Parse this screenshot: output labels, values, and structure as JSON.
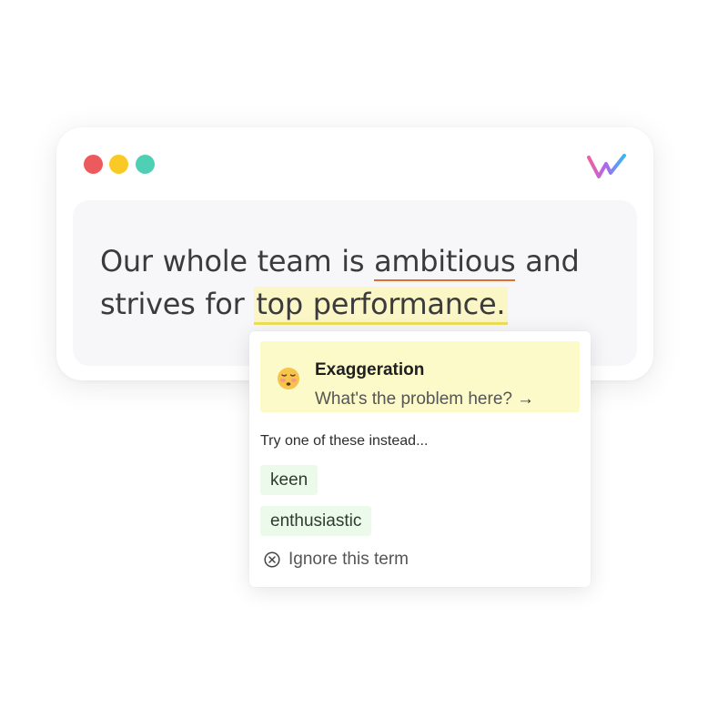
{
  "window": {
    "controls": [
      "close",
      "minimize",
      "maximize"
    ],
    "logo": "writing-assistant-logo",
    "colors": {
      "close": "#ec5a5e",
      "minimize": "#f9c926",
      "maximize": "#4fcfb3"
    }
  },
  "editor": {
    "segments": {
      "part1": "Our whole team is ",
      "flagged1": "ambitious",
      "part2": " and strives for ",
      "flagged2": "top performance."
    },
    "colors": {
      "underline": "#e0702f",
      "highlight": "#fbf6c6"
    }
  },
  "popup": {
    "issue": {
      "emoji": "flushed-face-icon",
      "title": "Exaggeration",
      "link": "What's the problem here?",
      "arrow": "→"
    },
    "hint": "Try one of these instead...",
    "suggestions": [
      "keen",
      "enthusiastic"
    ],
    "ignore_label": "Ignore this term",
    "colors": {
      "issue_bg": "#fdfac9",
      "suggestion_bg": "#ecfaeb"
    }
  }
}
